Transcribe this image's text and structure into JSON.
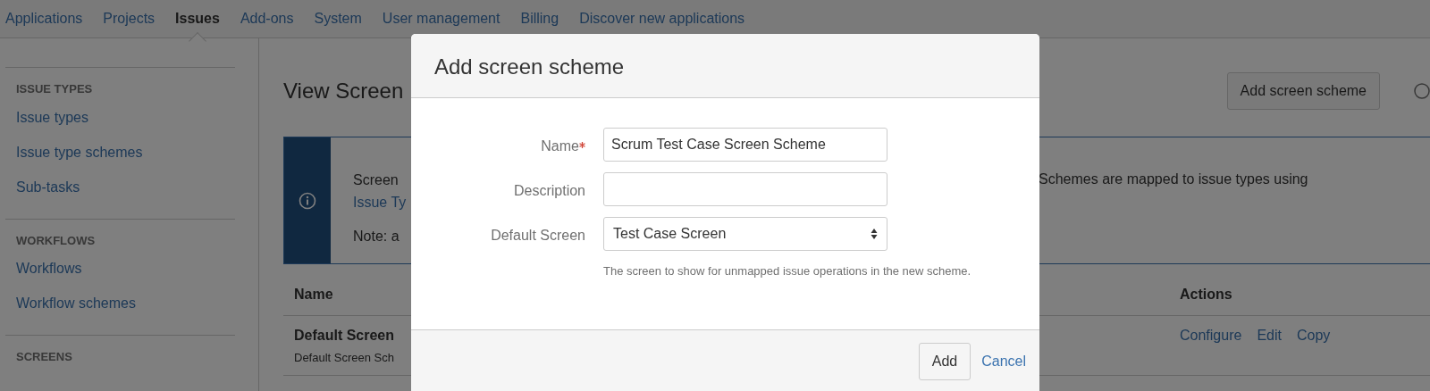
{
  "nav": [
    {
      "label": "Applications",
      "selected": false
    },
    {
      "label": "Projects",
      "selected": false
    },
    {
      "label": "Issues",
      "selected": true
    },
    {
      "label": "Add-ons",
      "selected": false
    },
    {
      "label": "System",
      "selected": false
    },
    {
      "label": "User management",
      "selected": false
    },
    {
      "label": "Billing",
      "selected": false
    },
    {
      "label": "Discover new applications",
      "selected": false
    }
  ],
  "sidebar": [
    {
      "heading": "ISSUE TYPES",
      "items": [
        "Issue types",
        "Issue type schemes",
        "Sub-tasks"
      ]
    },
    {
      "heading": "WORKFLOWS",
      "items": [
        "Workflows",
        "Workflow schemes"
      ]
    },
    {
      "heading": "SCREENS"
    }
  ],
  "page": {
    "title": "View Screen",
    "add_button": "Add screen scheme",
    "info": {
      "left": [
        {
          "kind": "text",
          "text": "Screen"
        },
        {
          "kind": "link",
          "text": "Issue Ty"
        },
        {
          "kind": "text",
          "text": "Note: a"
        }
      ],
      "right": "Schemes are mapped to issue types using"
    },
    "table": {
      "columns": [
        "Name",
        "Actions"
      ],
      "rows": [
        {
          "name": "Default Screen",
          "description": "Default Screen Sch",
          "actions": [
            "Configure",
            "Edit",
            "Copy"
          ]
        }
      ]
    }
  },
  "dialog": {
    "title": "Add screen scheme",
    "fields": [
      {
        "kind": "text",
        "label": "Name",
        "required": true,
        "value": "Scrum Test Case Screen Scheme"
      },
      {
        "kind": "text",
        "label": "Description",
        "required": false
      },
      {
        "kind": "select",
        "label": "Default Screen",
        "required": false,
        "value": "Test Case Screen",
        "help": "The screen to show for unmapped issue operations in the new scheme."
      }
    ],
    "submit": "Add",
    "cancel": "Cancel"
  }
}
